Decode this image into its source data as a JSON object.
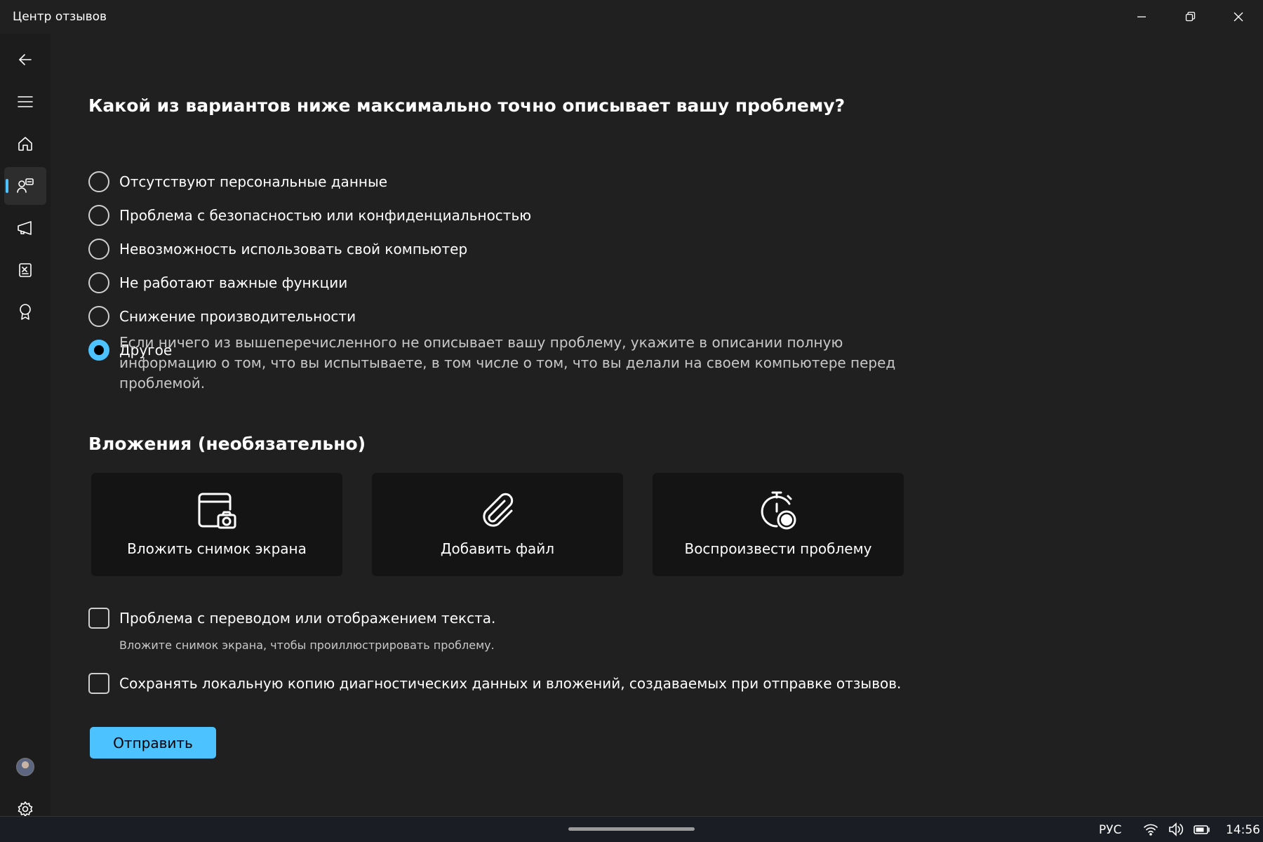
{
  "window": {
    "title": "Центр отзывов"
  },
  "question": {
    "title": "Какой из вариантов ниже максимально точно описывает вашу проблему?",
    "options": [
      {
        "label": "Отсутствуют персональные данные",
        "checked": false
      },
      {
        "label": "Проблема с безопасностью или конфиденциальностью",
        "checked": false
      },
      {
        "label": "Невозможность использовать свой компьютер",
        "checked": false
      },
      {
        "label": "Не работают важные функции",
        "checked": false
      },
      {
        "label": "Снижение производительности",
        "checked": false
      },
      {
        "label": "Другое",
        "checked": true
      }
    ],
    "other_hint": "Если ничего из вышеперечисленного не описывает вашу проблему, укажите в описании полную информацию о том, что вы испытываете, в том числе о том, что вы делали на своем компьютере перед проблемой."
  },
  "attachments": {
    "title": "Вложения (необязательно)",
    "tiles": [
      {
        "label": "Вложить снимок экрана",
        "icon": "screenshot-icon"
      },
      {
        "label": "Добавить файл",
        "icon": "paperclip-icon"
      },
      {
        "label": "Воспроизвести проблему",
        "icon": "stopwatch-record-icon"
      }
    ]
  },
  "checks": {
    "translation": {
      "label": "Проблема с переводом или отображением текста.",
      "sub": "Вложите снимок экрана, чтобы проиллюстрировать проблему.",
      "checked": false
    },
    "local_copy": {
      "label": "Сохранять локальную копию диагностических данных и вложений, создаваемых при отправке отзывов.",
      "checked": false
    }
  },
  "submit_label": "Отправить",
  "taskbar": {
    "lang": "РУС",
    "time": "14:56"
  },
  "colors": {
    "accent": "#4cc2ff",
    "background": "#202020",
    "sidebar": "#1c1c1c",
    "tile": "#141414"
  }
}
